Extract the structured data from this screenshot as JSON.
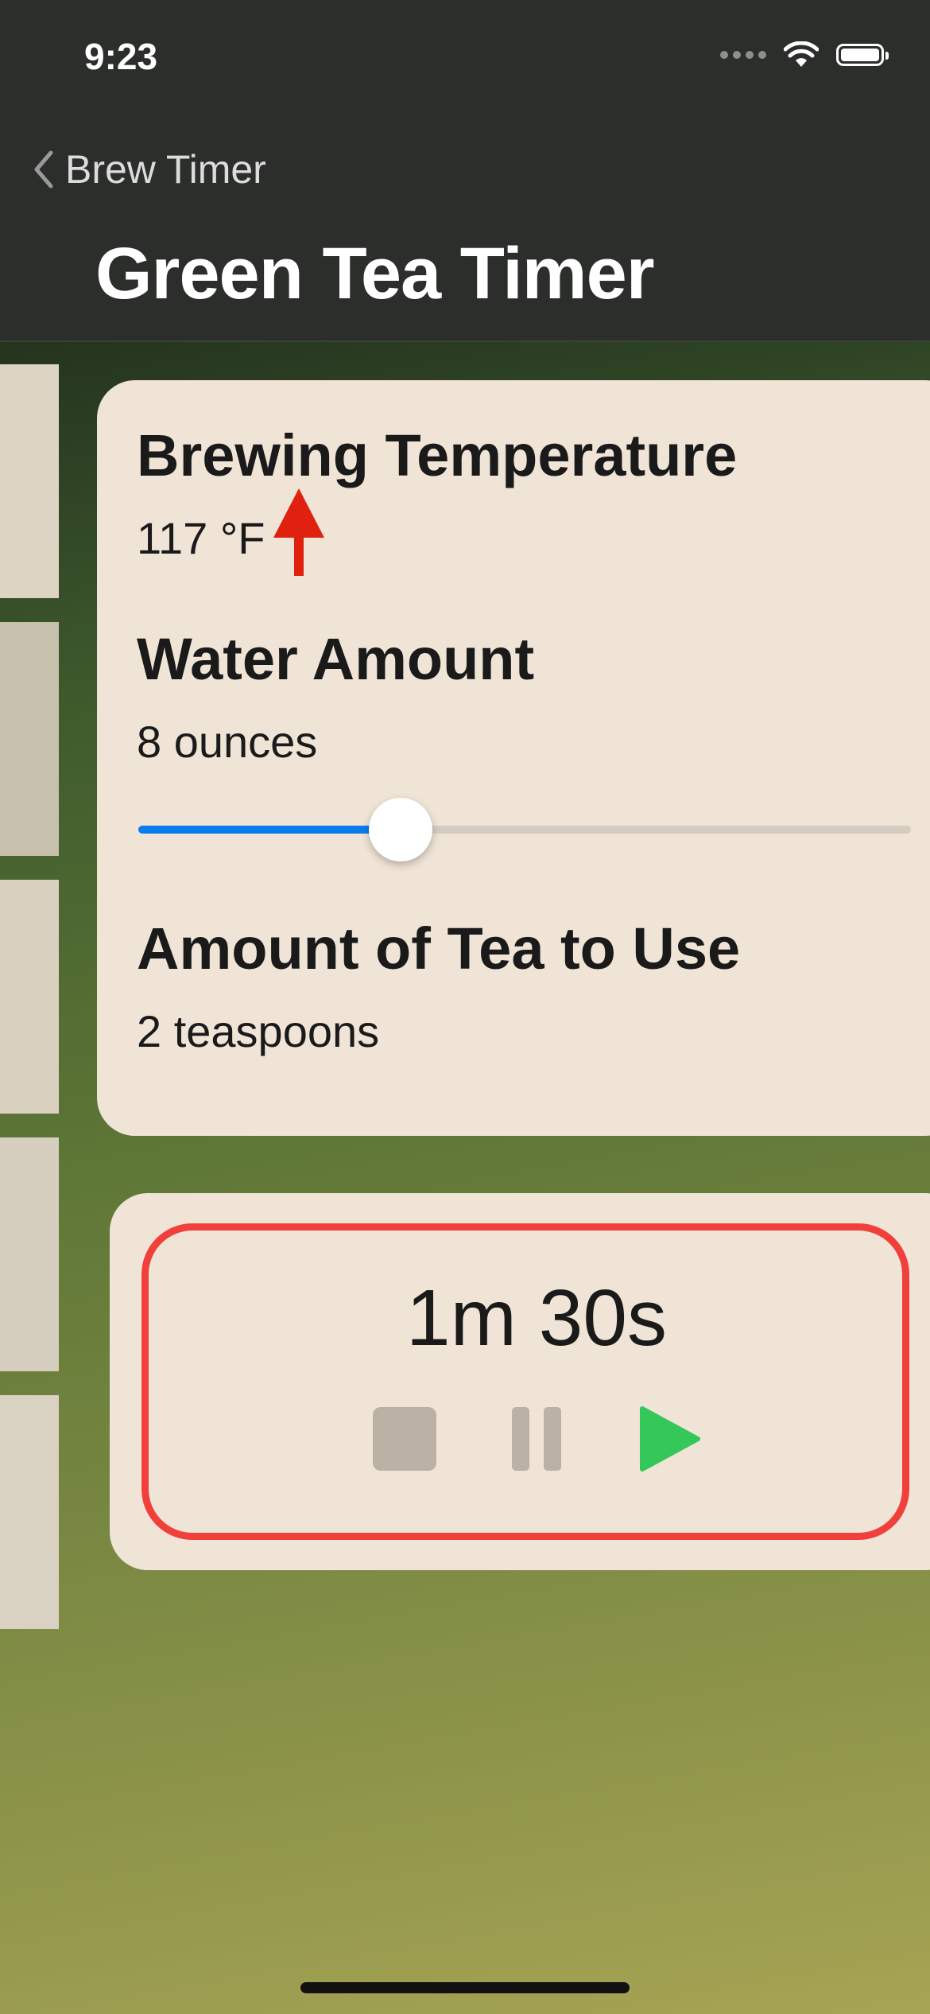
{
  "status_bar": {
    "time": "9:23",
    "icons": [
      "cellular-icon",
      "wifi-icon",
      "battery-icon"
    ]
  },
  "nav": {
    "back_label": "Brew Timer",
    "title": "Green Tea Timer"
  },
  "side_tiles": {
    "colors": [
      "#ddd4c4",
      "#c7c0ad",
      "#d9d0c0",
      "#d6cebe",
      "#d9d1c2"
    ]
  },
  "tea_info": {
    "temperature_heading": "Brewing Temperature",
    "temperature_value": "117 °F",
    "water_heading": "Water Amount",
    "water_value": "8 ounces",
    "water_slider_fraction": 0.34,
    "tea_heading": "Amount of Tea to Use",
    "tea_value": "2 teaspoons"
  },
  "timer": {
    "display": "1m 30s",
    "controls": [
      "stop-icon",
      "pause-icon",
      "play-icon"
    ]
  },
  "colors": {
    "card_background": "#efe4d6",
    "accent_blue": "#0a7cf0",
    "highlight_red": "#f1403b",
    "annotation_arrow_red": "#e0210f",
    "play_green": "#34c759",
    "disabled_control": "#bcb1a5"
  }
}
